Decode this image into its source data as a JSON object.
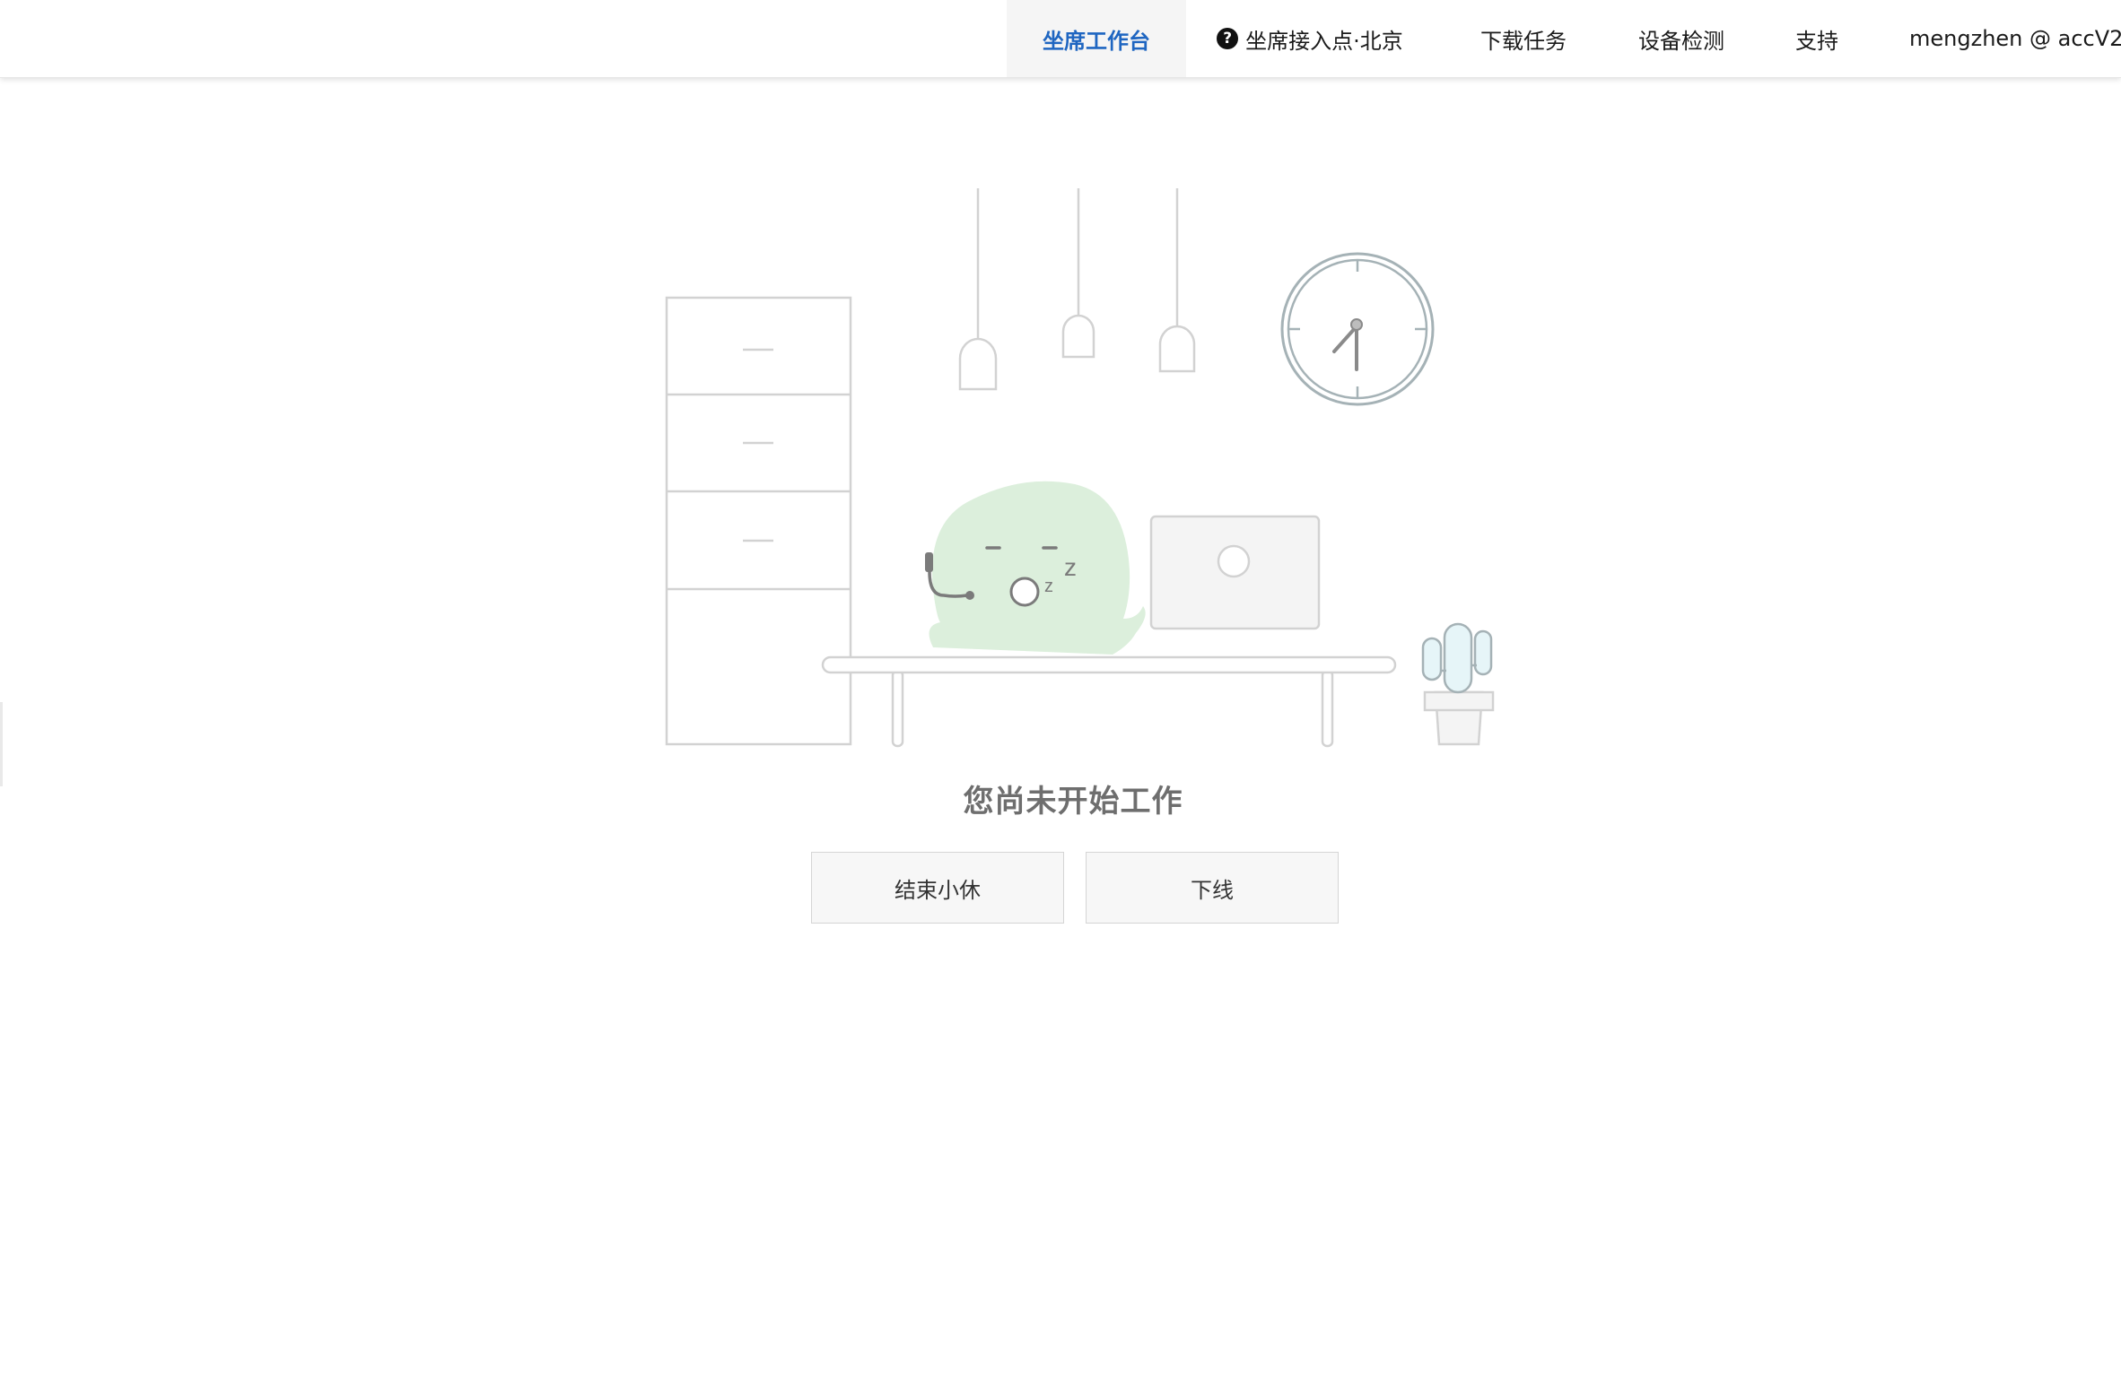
{
  "header": {
    "nav": [
      {
        "label": "坐席工作台",
        "active": true
      },
      {
        "label": "坐席接入点·北京",
        "icon": "help-icon"
      },
      {
        "label": "下载任务"
      },
      {
        "label": "设备检测"
      },
      {
        "label": "支持"
      },
      {
        "label": "mengzhen @ accV2"
      }
    ]
  },
  "main": {
    "status_text": "您尚未开始工作",
    "buttons": {
      "end_break": "结束小休",
      "go_offline": "下线"
    }
  },
  "colors": {
    "accent": "#1f66c1",
    "character": "#dcefdc",
    "cactus": "#e6f5f8"
  }
}
